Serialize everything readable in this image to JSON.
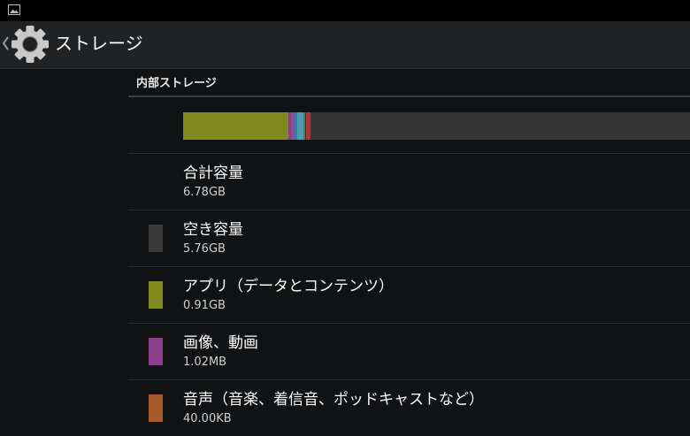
{
  "header": {
    "title": "ストレージ",
    "icon": "settings-gear-icon"
  },
  "section": {
    "title": "内部ストレージ"
  },
  "usage_bar": {
    "segments": [
      {
        "name": "apps",
        "fraction": 0.207,
        "color": "#828a1f"
      },
      {
        "name": "pictures-video",
        "fraction": 0.006,
        "color": "#8a3e8c"
      },
      {
        "name": "audio",
        "fraction": 0.006,
        "color": "#a34a78"
      },
      {
        "name": "downloads",
        "fraction": 0.007,
        "color": "#4a6fb0"
      },
      {
        "name": "cache",
        "fraction": 0.012,
        "color": "#4aa0a8"
      },
      {
        "name": "misc",
        "fraction": 0.004,
        "color": "#6a6a6a"
      },
      {
        "name": "other",
        "fraction": 0.008,
        "color": "#a33a3a"
      }
    ],
    "track_color": "#363636"
  },
  "rows": [
    {
      "label": "合計容量",
      "value": "6.78GB",
      "color": null
    },
    {
      "label": "空き容量",
      "value": "5.76GB",
      "color": "#3a3a3a"
    },
    {
      "label": "アプリ（データとコンテンツ）",
      "value": "0.91GB",
      "color": "#828a1f"
    },
    {
      "label": "画像、動画",
      "value": "1.02MB",
      "color": "#8a3e8c"
    },
    {
      "label": "音声（音楽、着信音、ポッドキャストなど）",
      "value": "40.00KB",
      "color": "#a65a2a"
    }
  ]
}
